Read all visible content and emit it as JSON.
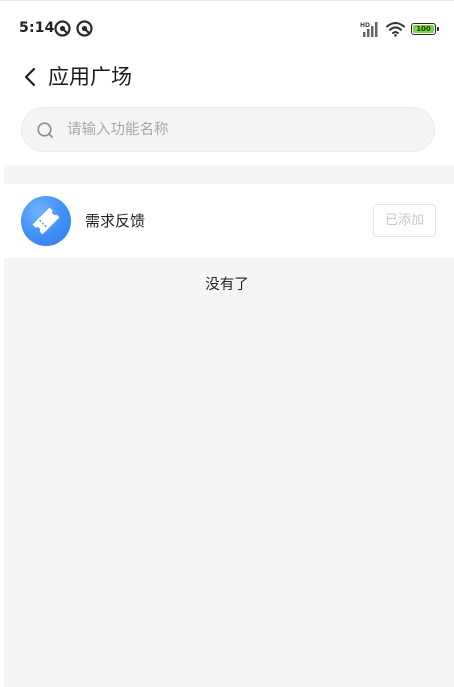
{
  "status_bar": {
    "time": "5:14",
    "network_label": "HD",
    "battery_level": "100",
    "battery_color": "#79d442"
  },
  "header": {
    "back_icon": "chevron-left-icon",
    "title": "应用广场"
  },
  "search": {
    "icon": "search-icon",
    "placeholder": "请输入功能名称",
    "value": ""
  },
  "apps": [
    {
      "name": "需求反馈",
      "icon": "ticket-icon",
      "icon_color": "#3f8ef5",
      "action_label": "已添加"
    }
  ],
  "list_end_text": "没有了"
}
